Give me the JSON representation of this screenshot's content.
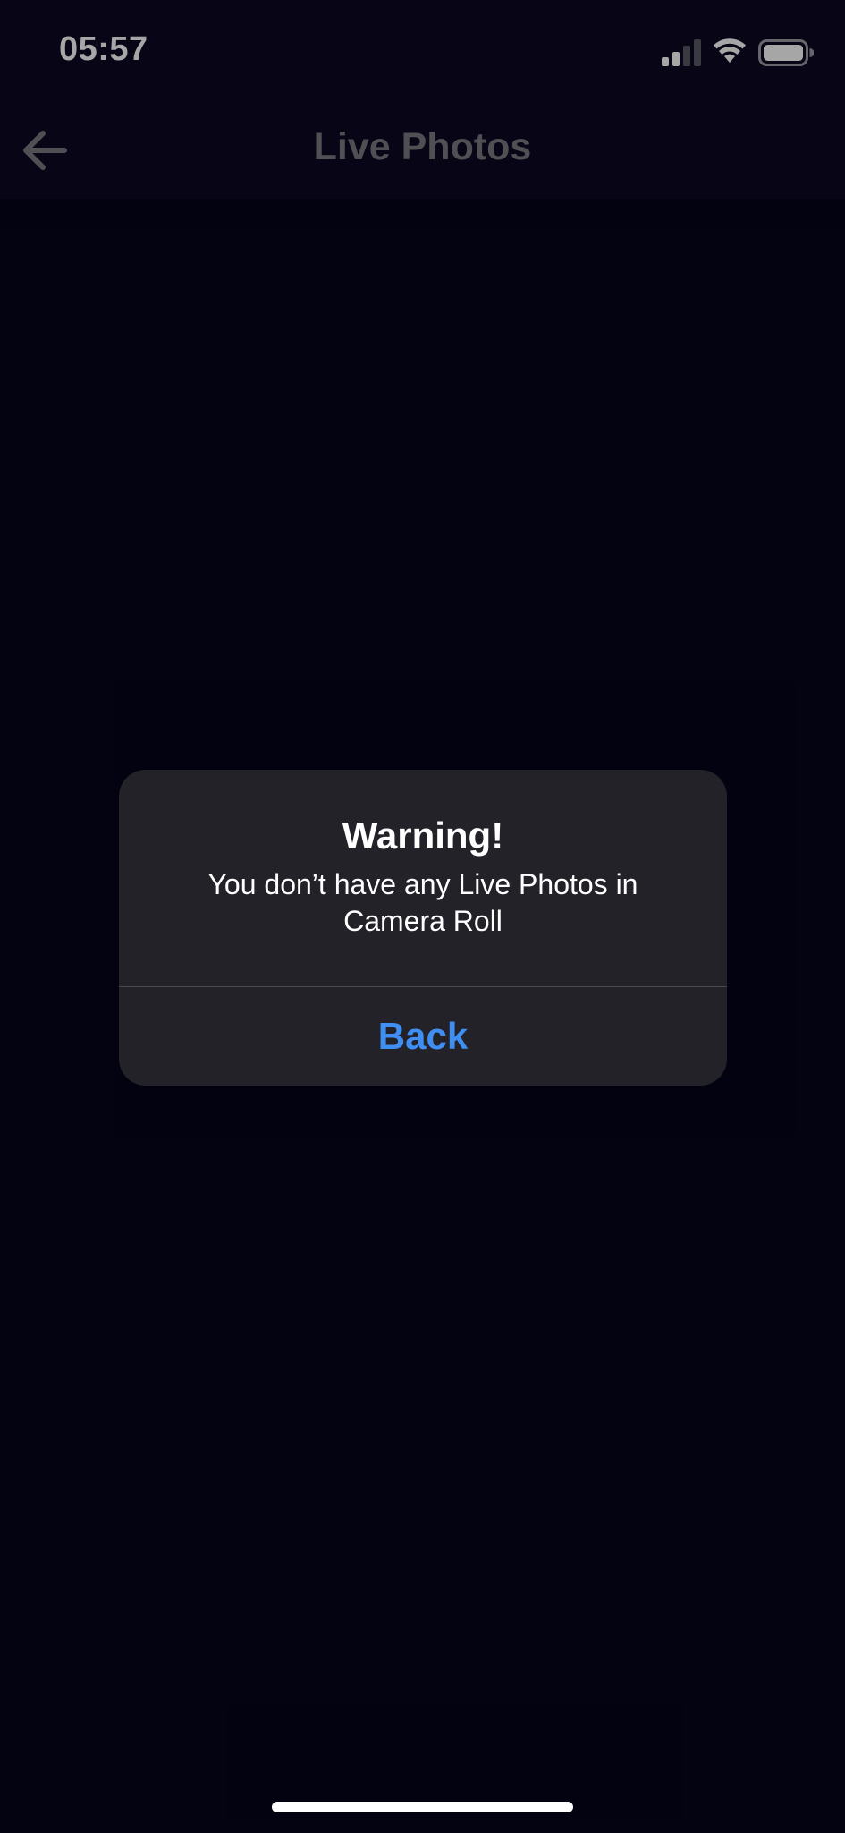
{
  "status_bar": {
    "time": "05:57",
    "signal_icon": "cellular-signal-icon",
    "wifi_icon": "wifi-icon",
    "battery_icon": "battery-icon"
  },
  "nav": {
    "title": "Live Photos",
    "back_icon": "back-arrow-icon"
  },
  "alert": {
    "title": "Warning!",
    "message": "You don’t have any Live Photos in Camera Roll",
    "button_label": "Back"
  },
  "colors": {
    "background": "#06041a",
    "alert_background": "#232229",
    "accent": "#3f8ef2",
    "nav_title": "#7c7c82"
  }
}
